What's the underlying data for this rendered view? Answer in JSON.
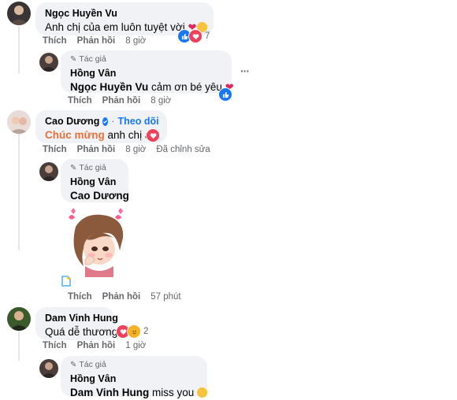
{
  "comments": [
    {
      "author": "Ngọc Huyền Vu",
      "text": "Anh chị của em luôn tuyệt vời",
      "actions": {
        "like": "Thích",
        "reply": "Phản hồi",
        "time": "8 giờ"
      },
      "reaction_count": "7",
      "reply": {
        "tag": "Tác giả",
        "author": "Hồng Vân",
        "mention": "Ngọc Huyền Vu",
        "text": " cảm ơn bé yêu",
        "actions": {
          "like": "Thích",
          "reply": "Phản hồi",
          "time": "8 giờ"
        }
      }
    },
    {
      "author": "Cao Dương",
      "follow": "Theo dõi",
      "text_highlight": "Chúc mừng",
      "text": " anh chị ạ",
      "actions": {
        "like": "Thích",
        "reply": "Phản hồi",
        "time": "8 giờ",
        "edited": "Đã chỉnh sửa"
      },
      "reply": {
        "tag": "Tác giả",
        "author": "Hồng Vân",
        "mention": "Cao Dương",
        "actions": {
          "like": "Thích",
          "reply": "Phản hồi",
          "time": "57 phút"
        }
      }
    },
    {
      "author": "Dam Vinh Hung",
      "text": "Quá dễ thương",
      "actions": {
        "like": "Thích",
        "reply": "Phản hồi",
        "time": "1 giờ"
      },
      "reaction_count": "2",
      "reply": {
        "tag": "Tác giả",
        "author": "Hồng Vân",
        "mention": "Dam Vinh Hung",
        "text": " miss you"
      }
    }
  ],
  "more_options": "···",
  "colors": {
    "like": "#1877f2",
    "love": "#f33e58",
    "highlight": "#e8713c",
    "bubble": "#f0f2f5"
  }
}
